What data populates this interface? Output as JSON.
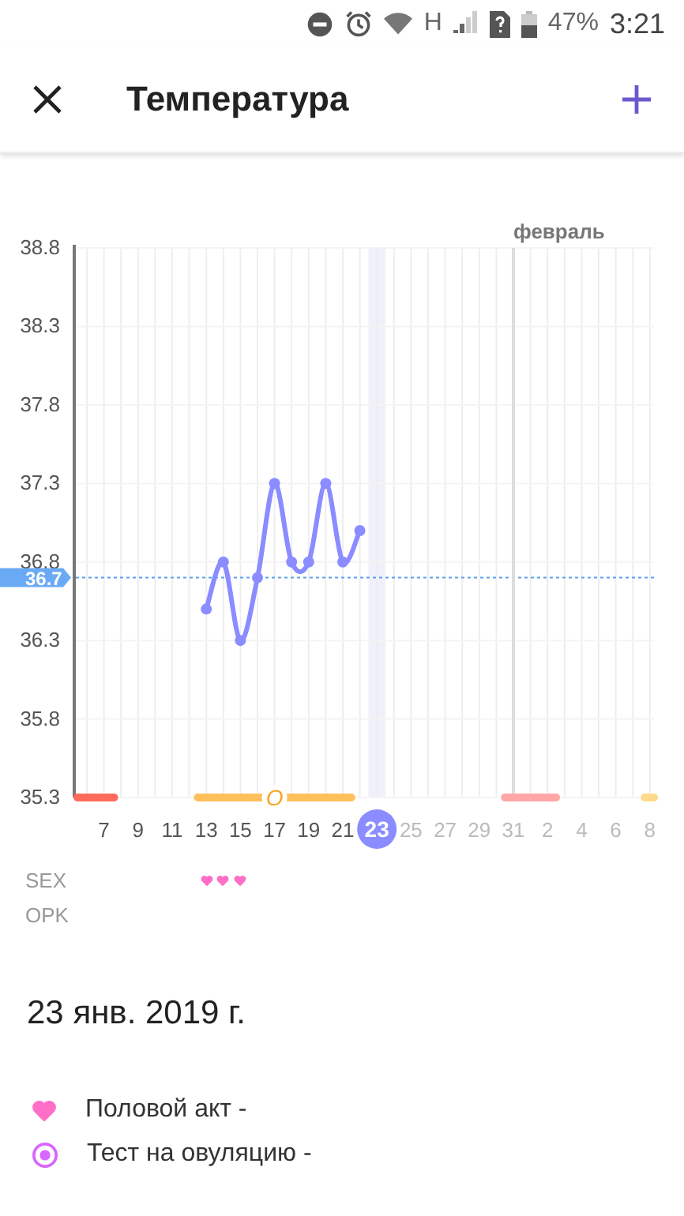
{
  "status_bar": {
    "network": "H",
    "battery": "47%",
    "time": "3:21"
  },
  "app_bar": {
    "title": "Температура"
  },
  "chart": {
    "month_label": "февраль",
    "next_month_days": [
      "2",
      "4",
      "6",
      "8"
    ],
    "days": [
      {
        "selected": false
      },
      {
        "selected": false
      },
      {
        "selected": false
      },
      {
        "selected": false
      },
      {
        "selected": false
      },
      {
        "selected": false
      },
      {
        "selected": false
      },
      {
        "selected": false
      },
      {
        "selected": true
      },
      {
        "selected": false
      },
      {
        "selected": false
      },
      {
        "selected": false
      },
      {
        "selected": false
      },
      {
        "selected": false
      },
      {
        "selected": false
      },
      {
        "selected": false
      },
      {
        "selected": false
      }
    ],
    "chart_data": {
      "type": "line",
      "grid": true,
      "xlim": [
        5.3,
        39.3
      ],
      "ylim": [
        35.3,
        38.8
      ],
      "yticks": [
        35.3,
        35.8,
        36.3,
        36.8,
        37.3,
        37.8,
        38.3,
        38.8
      ],
      "xticks": [
        {
          "value": 7,
          "label": "7"
        },
        {
          "value": 9,
          "label": "9"
        },
        {
          "value": 11,
          "label": "11"
        },
        {
          "value": 13,
          "label": "13"
        },
        {
          "value": 15,
          "label": "15"
        },
        {
          "value": 17,
          "label": "17"
        },
        {
          "value": 19,
          "label": "19"
        },
        {
          "value": 21,
          "label": "21"
        },
        {
          "value": 23,
          "label": "23"
        },
        {
          "value": 25,
          "label": "25"
        },
        {
          "value": 27,
          "label": "27"
        },
        {
          "value": 29,
          "label": "29"
        },
        {
          "value": 31,
          "label": "31"
        }
      ],
      "series": [
        {
          "color": "#8a8cff",
          "marker": "circle",
          "x": [
            13,
            14,
            15,
            16,
            17,
            18,
            19,
            20,
            21,
            22
          ],
          "values": [
            36.5,
            36.8,
            36.3,
            36.7,
            37.3,
            36.8,
            36.8,
            37.3,
            36.8,
            37.0
          ]
        },
        {
          "color": "#ff6b5b",
          "marker": "none",
          "x": [
            5.4,
            7.6
          ],
          "values": [
            35.3,
            35.3
          ]
        },
        {
          "color": "#ffc05c",
          "marker": "none",
          "x": [
            12.5,
            21.5
          ],
          "values": [
            35.3,
            35.3
          ]
        },
        {
          "color": "#ffa7a7",
          "marker": "none",
          "x": [
            30.5,
            33.5
          ],
          "values": [
            35.3,
            35.3
          ]
        },
        {
          "color": "#ffd98a",
          "marker": "none",
          "x": [
            38.7,
            39.3
          ],
          "values": [
            35.3,
            35.3
          ]
        }
      ],
      "ref_lines": [
        {
          "axis": "y",
          "value": 36.7,
          "label": "36.7",
          "color": "#5aa0f0"
        },
        {
          "axis": "x",
          "value": 31,
          "color": "#dddddd"
        }
      ],
      "bands": [
        {
          "axis": "x",
          "from": 22.5,
          "to": 23.5,
          "color": "#f0f0fb"
        }
      ],
      "annotations": [
        "O"
      ]
    }
  },
  "tracks": [
    {
      "label": "SEX",
      "marks": [
        {
          "kind": "heart"
        },
        {
          "kind": "heart"
        },
        {
          "kind": "heart"
        }
      ]
    },
    {
      "label": "OPK"
    }
  ],
  "date": "23 янв. 2019 г.",
  "legend": [
    {
      "kind": "heart",
      "label": "Половой акт -"
    },
    {
      "kind": "target",
      "label": "Тест на овуляцию -"
    }
  ]
}
